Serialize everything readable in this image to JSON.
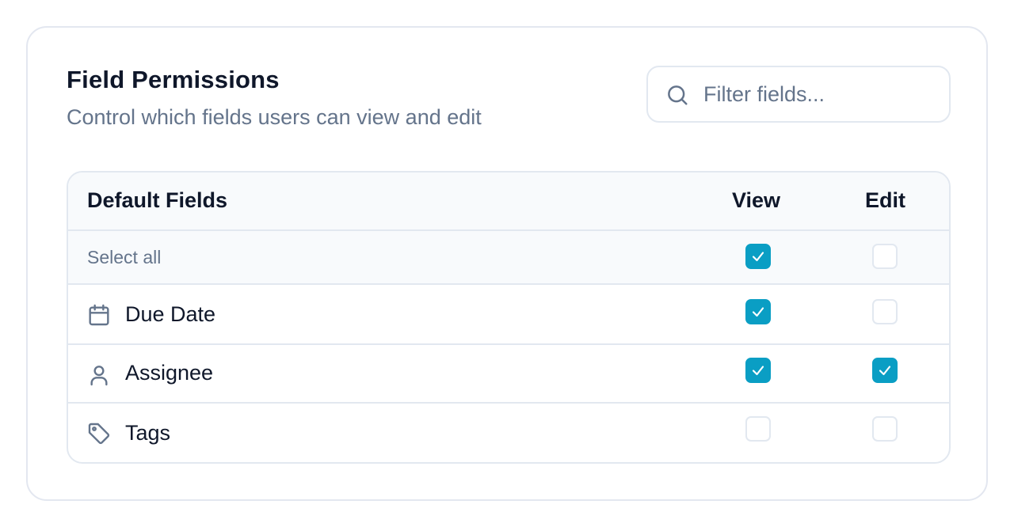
{
  "panel": {
    "title": "Field Permissions",
    "subtitle": "Control which fields users can view and edit"
  },
  "search": {
    "placeholder": "Filter fields...",
    "value": "",
    "icon": "search-icon"
  },
  "table": {
    "columns": {
      "field": "Default Fields",
      "view": "View",
      "edit": "Edit"
    },
    "select_all": {
      "label": "Select all",
      "view": true,
      "edit": false
    },
    "rows": [
      {
        "label": "Due Date",
        "icon": "calendar-icon",
        "view": true,
        "edit": false
      },
      {
        "label": "Assignee",
        "icon": "user-icon",
        "view": true,
        "edit": true
      },
      {
        "label": "Tags",
        "icon": "tag-icon",
        "view": false,
        "edit": false
      }
    ]
  },
  "colors": {
    "accent": "#0a9ec4",
    "muted_text": "#64748b",
    "border": "#e2e8f0"
  }
}
